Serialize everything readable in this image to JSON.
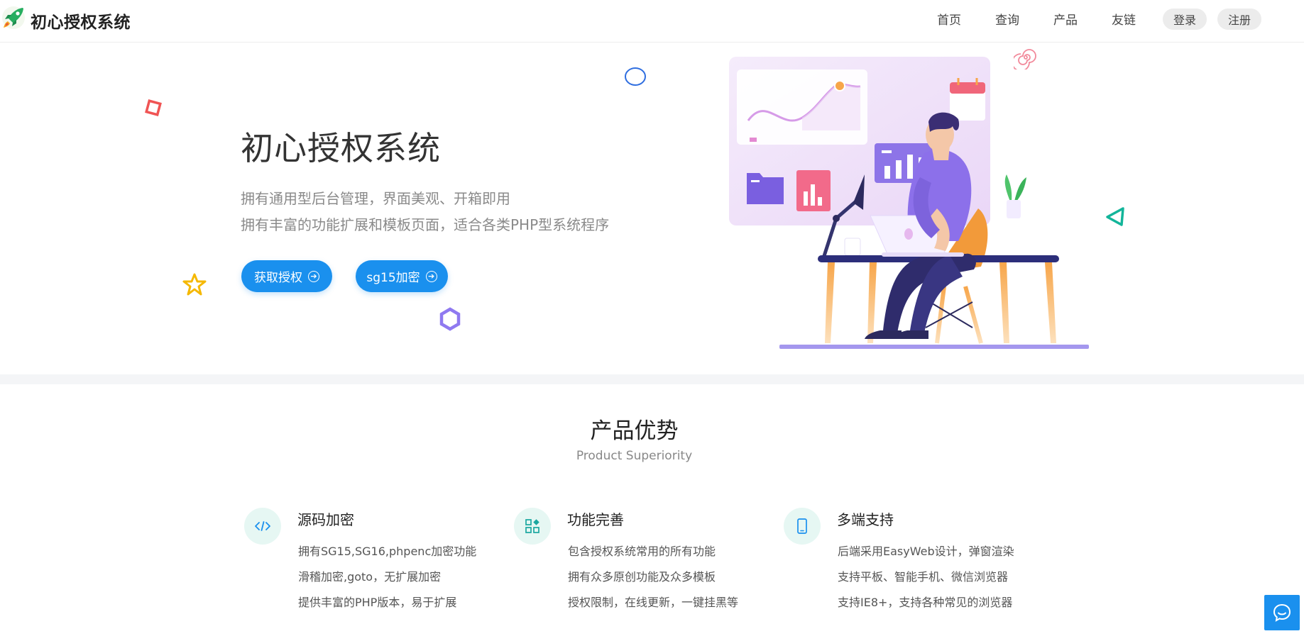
{
  "header": {
    "brand": "初心授权系统",
    "nav": [
      "首页",
      "查询",
      "产品",
      "友链"
    ],
    "login_label": "登录",
    "register_label": "注册"
  },
  "hero": {
    "title": "初心授权系统",
    "desc_lines": [
      "拥有通用型后台管理，界面美观、开箱即用",
      "拥有丰富的功能扩展和模板页面，适合各类PHP型系统程序"
    ],
    "btn_auth": "获取授权",
    "btn_encrypt": "sg15加密"
  },
  "features_section": {
    "title": "产品优势",
    "subtitle": "Product Superiority",
    "items": [
      {
        "icon": "code-icon",
        "title": "源码加密",
        "lines": [
          "拥有SG15,SG16,phpenc加密功能",
          "滑稽加密,goto，无扩展加密",
          "提供丰富的PHP版本，易于扩展"
        ]
      },
      {
        "icon": "widgets-icon",
        "title": "功能完善",
        "lines": [
          "包含授权系统常用的所有功能",
          "拥有众多原创功能及众多模板",
          "授权限制，在线更新，一键挂黑等"
        ]
      },
      {
        "icon": "tablet-icon",
        "title": "多端支持",
        "lines": [
          "后端采用EasyWeb设计，弹窗渲染",
          "支持平板、智能手机、微信浏览器",
          "支持IE8+，支持各种常见的浏览器"
        ]
      }
    ]
  },
  "colors": {
    "accent": "#1a90ee",
    "icon_bg": "#e6f7f3",
    "code_icon": "#1a90ee",
    "widgets_icon": "#1aa7a0"
  }
}
